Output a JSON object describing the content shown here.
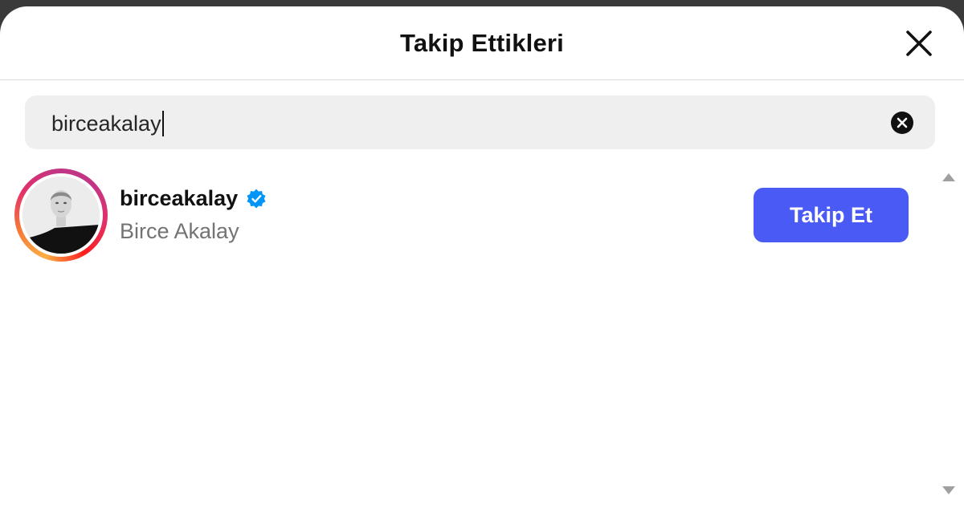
{
  "header": {
    "title": "Takip Ettikleri",
    "close_icon": "close-icon"
  },
  "search": {
    "value": "birceakalay",
    "clear_icon": "clear-circle-icon"
  },
  "results": [
    {
      "username": "birceakalay",
      "full_name": "Birce Akalay",
      "verified": true,
      "verified_color": "#0095f6",
      "action_label": "Takip Et"
    }
  ],
  "colors": {
    "accent": "#4a5af5",
    "secondary_text": "#737373",
    "search_bg": "#efefef"
  }
}
